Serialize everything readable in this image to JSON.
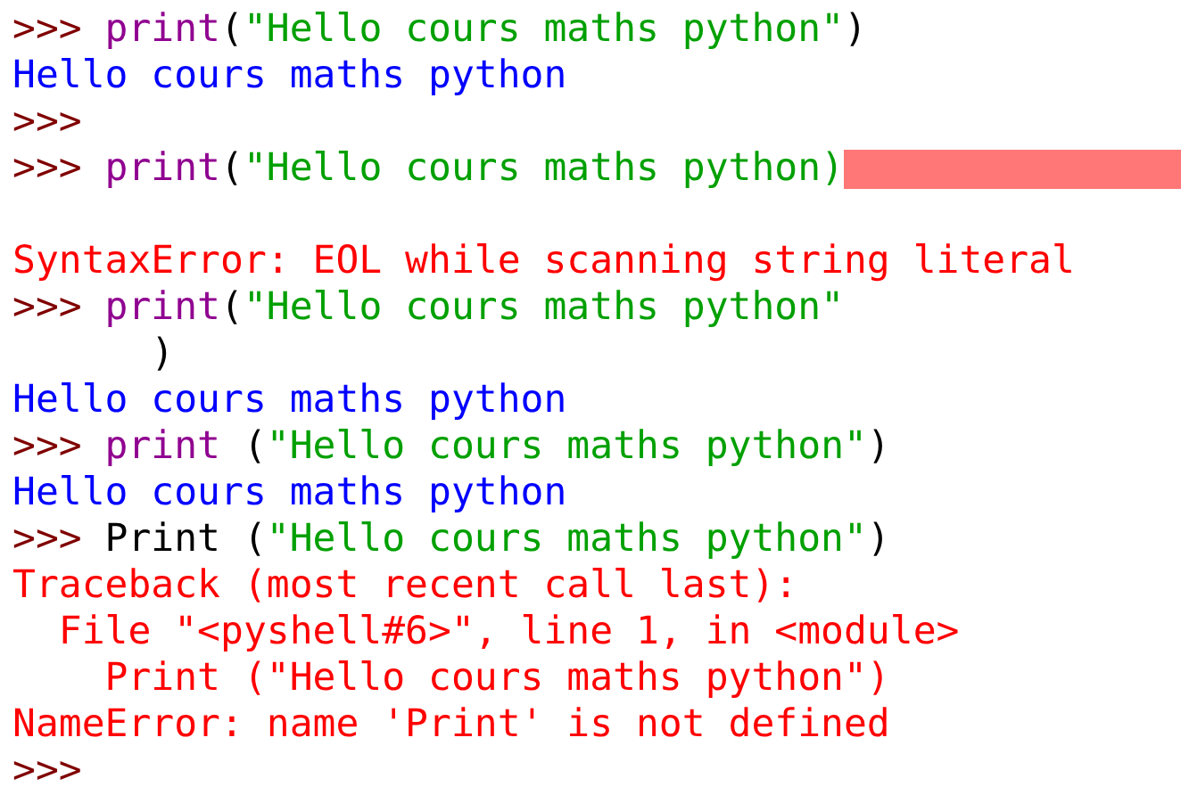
{
  "shell_lines": [
    {
      "kind": "text",
      "segments": [
        {
          "kind": "prompt",
          "text": ">>> "
        },
        {
          "kind": "builtin",
          "text": "print"
        },
        {
          "kind": "plain",
          "text": "("
        },
        {
          "kind": "string",
          "text": "\"Hello cours maths python\""
        },
        {
          "kind": "plain",
          "text": ")"
        }
      ]
    },
    {
      "kind": "text",
      "segments": [
        {
          "kind": "output",
          "text": "Hello cours maths python"
        }
      ]
    },
    {
      "kind": "text",
      "segments": [
        {
          "kind": "prompt",
          "text": ">>>"
        }
      ]
    },
    {
      "kind": "text",
      "error_marker": true,
      "segments": [
        {
          "kind": "prompt",
          "text": ">>> "
        },
        {
          "kind": "builtin",
          "text": "print"
        },
        {
          "kind": "plain",
          "text": "("
        },
        {
          "kind": "string",
          "text": "\"Hello cours maths python)"
        }
      ]
    },
    {
      "kind": "blank"
    },
    {
      "kind": "text",
      "segments": [
        {
          "kind": "error",
          "text": "SyntaxError: EOL while scanning string literal"
        }
      ]
    },
    {
      "kind": "text",
      "segments": [
        {
          "kind": "prompt",
          "text": ">>> "
        },
        {
          "kind": "builtin",
          "text": "print"
        },
        {
          "kind": "plain",
          "text": "("
        },
        {
          "kind": "string",
          "text": "\"Hello cours maths python\""
        }
      ]
    },
    {
      "kind": "text",
      "segments": [
        {
          "kind": "plain",
          "text": "      )"
        }
      ]
    },
    {
      "kind": "text",
      "segments": [
        {
          "kind": "output",
          "text": "Hello cours maths python"
        }
      ]
    },
    {
      "kind": "text",
      "segments": [
        {
          "kind": "prompt",
          "text": ">>> "
        },
        {
          "kind": "builtin",
          "text": "print"
        },
        {
          "kind": "plain",
          "text": " ("
        },
        {
          "kind": "string",
          "text": "\"Hello cours maths python\""
        },
        {
          "kind": "plain",
          "text": ")"
        }
      ]
    },
    {
      "kind": "text",
      "segments": [
        {
          "kind": "output",
          "text": "Hello cours maths python"
        }
      ]
    },
    {
      "kind": "text",
      "segments": [
        {
          "kind": "prompt",
          "text": ">>> "
        },
        {
          "kind": "plain",
          "text": "Print ("
        },
        {
          "kind": "string",
          "text": "\"Hello cours maths python\""
        },
        {
          "kind": "plain",
          "text": ")"
        }
      ]
    },
    {
      "kind": "text",
      "segments": [
        {
          "kind": "error",
          "text": "Traceback (most recent call last):"
        }
      ]
    },
    {
      "kind": "text",
      "segments": [
        {
          "kind": "error",
          "text": "  File \"<pyshell#6>\", line 1, in <module>"
        }
      ]
    },
    {
      "kind": "text",
      "segments": [
        {
          "kind": "error",
          "text": "    Print (\"Hello cours maths python\")"
        }
      ]
    },
    {
      "kind": "text",
      "segments": [
        {
          "kind": "error",
          "text": "NameError: name 'Print' is not defined"
        }
      ]
    },
    {
      "kind": "text",
      "segments": [
        {
          "kind": "prompt",
          "text": ">>>"
        }
      ]
    }
  ]
}
